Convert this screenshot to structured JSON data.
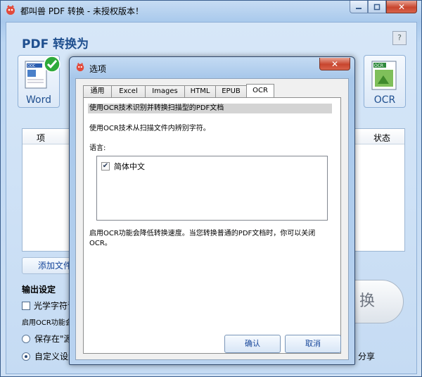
{
  "window": {
    "title": "都叫兽 PDF 转换 - 未授权版本！"
  },
  "main": {
    "convert_to_label": "PDF 转换为",
    "help_label": "?",
    "formats": [
      {
        "label": "Word",
        "icon": "word-doc-icon"
      },
      {
        "label": "OCR",
        "icon": "ocr-image-icon"
      }
    ],
    "table_headers": {
      "item": "项",
      "status": "状态"
    },
    "add_file_label": "添加文件",
    "output_settings_label": "输出设定",
    "ocr_checkbox_label": "光学字符识",
    "ocr_note": "启用OCR功能会",
    "save_source_label": "保存在\"源文",
    "custom_setting_label": "自定义设置",
    "convert_label": "换",
    "share_label": "分享"
  },
  "dialog": {
    "title": "选项",
    "tabs": [
      "通用",
      "Excel",
      "Images",
      "HTML",
      "EPUB",
      "OCR"
    ],
    "active_tab": "OCR",
    "heading": "使用OCR技术识别并转换扫描型的PDF文档",
    "description": "使用OCR技术从扫描文件内辨别字符。",
    "language_label": "语言:",
    "languages": [
      {
        "name": "简体中文",
        "checked": true
      }
    ],
    "hint": "启用OCR功能会降低转换速度。当您转换普通的PDF文档时，你可以关闭OCR。",
    "ok_label": "确认",
    "cancel_label": "取消"
  }
}
